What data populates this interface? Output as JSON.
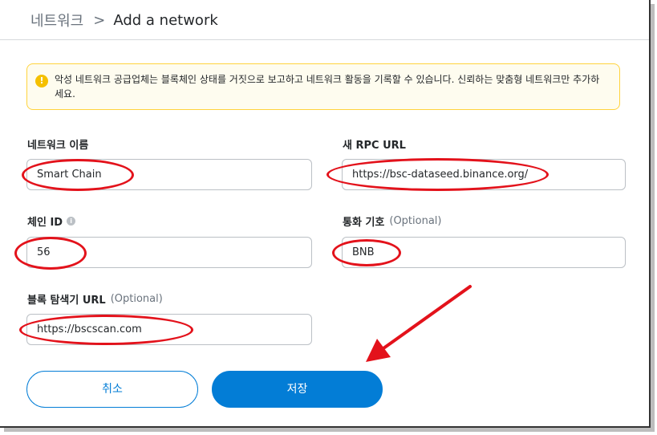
{
  "header": {
    "root_label": "네트워크",
    "separator": ">",
    "current_label": "Add a network"
  },
  "alert": {
    "icon": "!",
    "text": "악성 네트워크 공급업체는 블록체인 상태를 거짓으로 보고하고 네트워크 활동을 기록할 수 있습니다. 신뢰하는 맞춤형 네트워크만 추가하세요."
  },
  "fields": {
    "network_name": {
      "label": "네트워크 이름",
      "value": "Smart Chain"
    },
    "rpc_url": {
      "label": "새 RPC URL",
      "value": "https://bsc-dataseed.binance.org/"
    },
    "chain_id": {
      "label": "체인 ID",
      "info_icon": "i",
      "value": "56"
    },
    "currency_symbol": {
      "label": "통화 기호",
      "optional": "(Optional)",
      "value": "BNB"
    },
    "explorer_url": {
      "label": "블록 탐색기 URL",
      "optional": "(Optional)",
      "value": "https://bscscan.com"
    }
  },
  "buttons": {
    "cancel": "취소",
    "save": "저장"
  },
  "colors": {
    "accent": "#037dd6",
    "annotation": "#e3121b",
    "alert_bg": "#fefcef",
    "alert_border": "#ffd33d"
  },
  "icons": {
    "alert": "warning-icon",
    "info": "info-icon",
    "annotation_arrow": "arrow-icon"
  }
}
